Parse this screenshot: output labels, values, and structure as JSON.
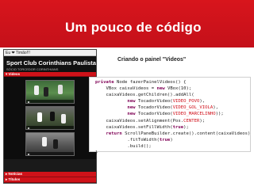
{
  "slide": {
    "title": "Um pouco de código",
    "subtitle": "Criando o painel \"Videos\"",
    "accent": "#d0151c"
  },
  "app": {
    "window_title": "Eu ❤ Timão!!!",
    "header_title": "Sport Club Corinthians Paulista",
    "header_sub": "SÓCIO TORCEDOR CORINTHIANS",
    "section_videos": "▾ Videos",
    "section_noticias": "▸ Notícias",
    "section_titulos": "▸ Títulos",
    "videos": [
      {
        "name": "VIDEO_POVO",
        "icon": "play-icon"
      },
      {
        "name": "VIDEO_GOL_VIOLA",
        "icon": "play-icon"
      },
      {
        "name": "VIDEO_MARCELINHO",
        "icon": "play-icon"
      }
    ]
  },
  "code": {
    "lines": [
      {
        "parts": [
          {
            "t": "private",
            "c": "kw"
          },
          {
            "t": " Node fazerPainelVideos() {",
            "c": ""
          }
        ]
      },
      {
        "parts": [
          {
            "t": "    VBox caixaVideos = ",
            "c": ""
          },
          {
            "t": "new",
            "c": "kw"
          },
          {
            "t": " VBox(10);",
            "c": ""
          }
        ]
      },
      {
        "parts": [
          {
            "t": "    caixaVideos.getChildren().addAll(",
            "c": ""
          }
        ]
      },
      {
        "parts": [
          {
            "t": "            ",
            "c": ""
          },
          {
            "t": "new",
            "c": "kw"
          },
          {
            "t": " TocadorVideo(",
            "c": ""
          },
          {
            "t": "VIDEO_POVO",
            "c": "str"
          },
          {
            "t": "),",
            "c": ""
          }
        ]
      },
      {
        "parts": [
          {
            "t": "            ",
            "c": ""
          },
          {
            "t": "new",
            "c": "kw"
          },
          {
            "t": " TocadorVideo(",
            "c": ""
          },
          {
            "t": "VIDEO_GOL_VIOLA",
            "c": "str"
          },
          {
            "t": "),",
            "c": ""
          }
        ]
      },
      {
        "parts": [
          {
            "t": "            ",
            "c": ""
          },
          {
            "t": "new",
            "c": "kw"
          },
          {
            "t": " TocadorVideo(",
            "c": ""
          },
          {
            "t": "VIDEO_MARCELINHO",
            "c": "str"
          },
          {
            "t": "));",
            "c": ""
          }
        ]
      },
      {
        "parts": [
          {
            "t": "    caixaVideos.setAlignment(Pos.",
            "c": ""
          },
          {
            "t": "CENTER",
            "c": "str"
          },
          {
            "t": ");",
            "c": ""
          }
        ]
      },
      {
        "parts": [
          {
            "t": "    caixaVideos.setFillWidth(",
            "c": ""
          },
          {
            "t": "true",
            "c": "kw"
          },
          {
            "t": ");",
            "c": ""
          }
        ]
      },
      {
        "parts": [
          {
            "t": "    ",
            "c": ""
          },
          {
            "t": "return",
            "c": "kw"
          },
          {
            "t": " ScrollPaneBuilder.create().content(caixaVideos)",
            "c": ""
          }
        ]
      },
      {
        "parts": [
          {
            "t": "            .fitToWidth(",
            "c": ""
          },
          {
            "t": "true",
            "c": "kw"
          },
          {
            "t": ")",
            "c": ""
          }
        ]
      },
      {
        "parts": [
          {
            "t": "            .build();",
            "c": ""
          }
        ]
      },
      {
        "parts": [
          {
            "t": "}",
            "c": ""
          }
        ]
      }
    ]
  }
}
